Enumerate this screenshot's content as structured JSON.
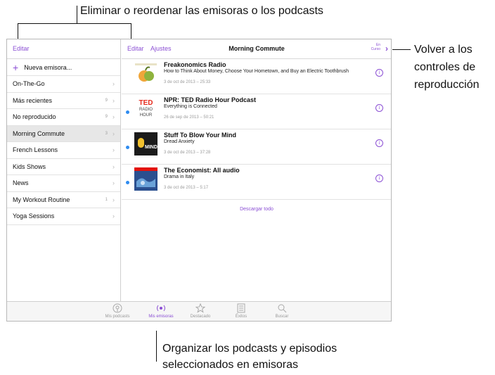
{
  "callouts": {
    "top": "Eliminar o reordenar las emisoras o los podcasts",
    "right_1": "Volver a los",
    "right_2": "controles de",
    "right_3": "reproducción",
    "bottom_1": "Organizar los podcasts y episodios",
    "bottom_2": "seleccionados en emisoras"
  },
  "sidebar": {
    "edit_label": "Editar",
    "new_station_label": "Nueva emisora...",
    "items": [
      {
        "label": "On-The-Go",
        "count": ""
      },
      {
        "label": "Más recientes",
        "count": "9"
      },
      {
        "label": "No reproducido",
        "count": "9"
      },
      {
        "label": "Morning Commute",
        "count": "3",
        "selected": true
      },
      {
        "label": "French Lessons",
        "count": ""
      },
      {
        "label": "Kids Shows",
        "count": ""
      },
      {
        "label": "News",
        "count": ""
      },
      {
        "label": "My Workout Routine",
        "count": "1"
      },
      {
        "label": "Yoga Sessions",
        "count": ""
      }
    ]
  },
  "header": {
    "edit_label": "Editar",
    "settings_label": "Ajustes",
    "title": "Morning Commute",
    "now_playing_line1": "En",
    "now_playing_line2": "Curso"
  },
  "episodes": [
    {
      "podcast": "Freakonomics Radio",
      "episode": "How to Think About Money, Choose Your Hometown, and Buy an Electric Toothbrush",
      "date": "3 de oct de 2013 – 25:33",
      "unplayed": false,
      "art_icon": "freakonomics-artwork"
    },
    {
      "podcast": "NPR: TED Radio Hour Podcast",
      "episode": "Everything is Connected",
      "date": "26 de sep de 2013 – 50:21",
      "unplayed": true,
      "art_icon": "ted-radio-hour-artwork",
      "art_text": [
        "TED",
        "RADIO",
        "HOUR"
      ]
    },
    {
      "podcast": "Stuff To Blow Your Mind",
      "episode": "Dread Anxiety",
      "date": "3 de oct de 2013 – 37:28",
      "unplayed": true,
      "art_icon": "stuff-to-blow-your-mind-artwork",
      "art_text": [
        "MIND"
      ]
    },
    {
      "podcast": "The Economist: All audio",
      "episode": "Drama in Italy",
      "date": "3 de oct de 2013 – 5:17",
      "unplayed": true,
      "art_icon": "economist-artwork"
    }
  ],
  "download_all_label": "Descargar todo",
  "tabs": [
    {
      "label": "Mis podcasts",
      "icon": "podcast-icon",
      "active": false
    },
    {
      "label": "Mis emisoras",
      "icon": "stations-icon",
      "active": true
    },
    {
      "label": "Destacado",
      "icon": "star-icon",
      "active": false
    },
    {
      "label": "Éxitos",
      "icon": "top-charts-icon",
      "active": false
    },
    {
      "label": "Buscar",
      "icon": "search-icon",
      "active": false
    }
  ],
  "colors": {
    "accent": "#8b4fd4",
    "unplayed_dot": "#2f8cf0",
    "selected_row": "#e7e7e7"
  }
}
